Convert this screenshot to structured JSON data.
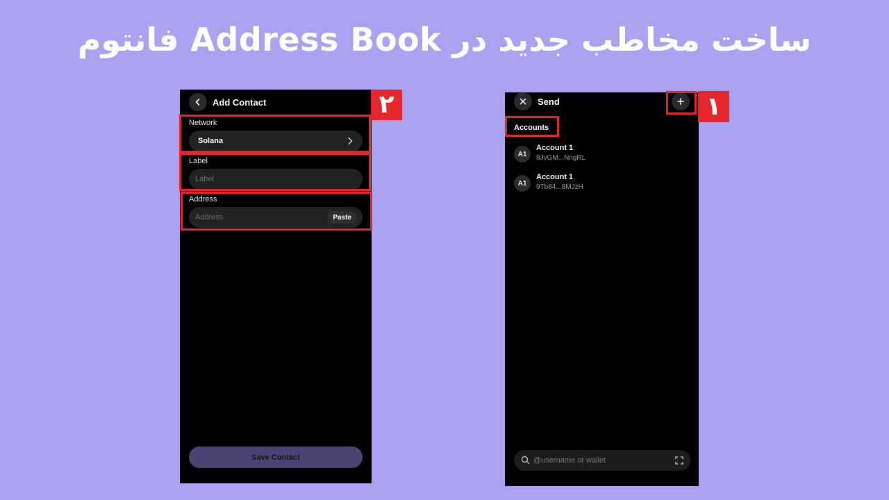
{
  "page": {
    "title": "ساخت مخاطب جدید در Address Book فانتوم",
    "highlight_color": "#e5262b",
    "background_color": "#aaa2f0"
  },
  "steps": {
    "step1": "۱",
    "step2": "۲"
  },
  "add_contact": {
    "back_icon": "chevron-left-icon",
    "title": "Add Contact",
    "network_label": "Network",
    "network_value": "Solana",
    "network_icon": "chevron-right-icon",
    "label_label": "Label",
    "label_placeholder": "Label",
    "address_label": "Address",
    "address_placeholder": "Address",
    "paste_label": "Paste",
    "save_label": "Save Contact",
    "save_color": "#4b4472"
  },
  "send": {
    "close_icon": "close-icon",
    "title": "Send",
    "add_icon": "plus-icon",
    "add_label": "+",
    "accounts_tab": "Accounts",
    "accounts": [
      {
        "avatar": "A1",
        "name": "Account 1",
        "address": "8JvGM...NngRL"
      },
      {
        "avatar": "A1",
        "name": "Account 1",
        "address": "9Tb84...8MJzH"
      }
    ],
    "search_icon": "search-icon",
    "search_placeholder": "@username or wallet",
    "scan_icon": "scan-icon"
  }
}
